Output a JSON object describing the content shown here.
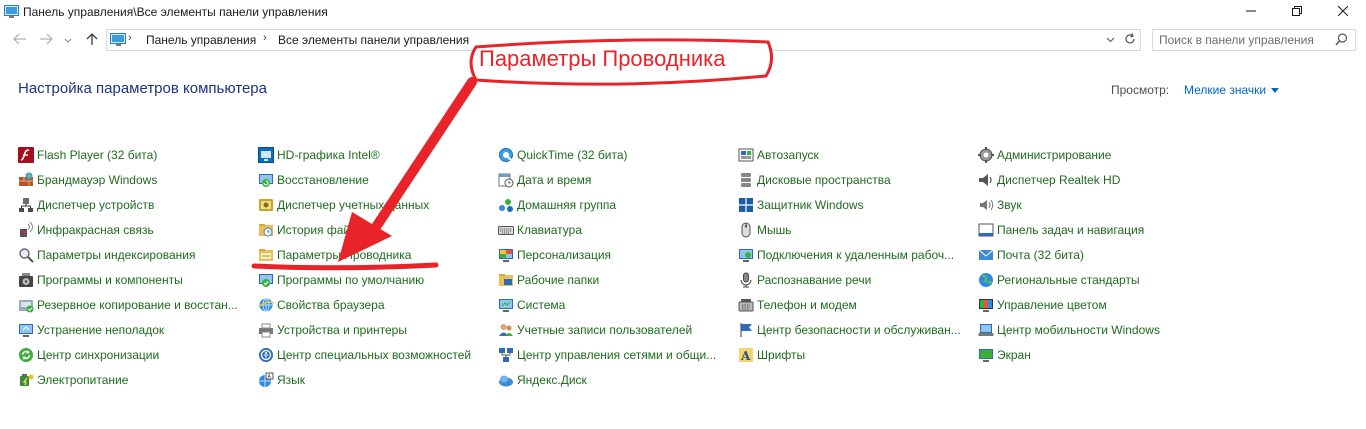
{
  "window": {
    "title": "Панель управления\\Все элементы панели управления",
    "minimize_icon": "minimize-icon",
    "maximize_icon": "maximize-icon",
    "close_icon": "close-icon"
  },
  "nav": {
    "breadcrumb": [
      "Панель управления",
      "Все элементы панели управления"
    ],
    "search_placeholder": "Поиск в панели управления"
  },
  "header": {
    "title": "Настройка параметров компьютера",
    "view_label": "Просмотр:",
    "view_value": "Мелкие значки"
  },
  "annotation": {
    "text": "Параметры Проводника",
    "color": "#e8242a"
  },
  "items": {
    "col1": [
      {
        "label": "Flash Player (32 бита)",
        "icon": "flash-icon"
      },
      {
        "label": "Брандмауэр Windows",
        "icon": "firewall-icon"
      },
      {
        "label": "Диспетчер устройств",
        "icon": "device-manager-icon"
      },
      {
        "label": "Инфракрасная связь",
        "icon": "infrared-icon"
      },
      {
        "label": "Параметры индексирования",
        "icon": "indexing-icon"
      },
      {
        "label": "Программы и компоненты",
        "icon": "programs-icon"
      },
      {
        "label": "Резервное копирование и восстан...",
        "icon": "backup-icon"
      },
      {
        "label": "Устранение неполадок",
        "icon": "troubleshoot-icon"
      },
      {
        "label": "Центр синхронизации",
        "icon": "sync-center-icon"
      },
      {
        "label": "Электропитание",
        "icon": "power-icon"
      }
    ],
    "col2": [
      {
        "label": "HD-графика Intel®",
        "icon": "intel-graphics-icon"
      },
      {
        "label": "Восстановление",
        "icon": "recovery-icon"
      },
      {
        "label": "Диспетчер учетных данных",
        "icon": "credential-manager-icon"
      },
      {
        "label": "История файлов",
        "icon": "file-history-icon"
      },
      {
        "label": "Параметры Проводника",
        "icon": "explorer-options-icon"
      },
      {
        "label": "Программы по умолчанию",
        "icon": "default-programs-icon"
      },
      {
        "label": "Свойства браузера",
        "icon": "internet-options-icon"
      },
      {
        "label": "Устройства и принтеры",
        "icon": "devices-printers-icon"
      },
      {
        "label": "Центр специальных возможностей",
        "icon": "ease-of-access-icon"
      },
      {
        "label": "Язык",
        "icon": "language-icon"
      }
    ],
    "col3": [
      {
        "label": "QuickTime (32 бита)",
        "icon": "quicktime-icon"
      },
      {
        "label": "Дата и время",
        "icon": "date-time-icon"
      },
      {
        "label": "Домашняя группа",
        "icon": "homegroup-icon"
      },
      {
        "label": "Клавиатура",
        "icon": "keyboard-icon"
      },
      {
        "label": "Персонализация",
        "icon": "personalization-icon"
      },
      {
        "label": "Рабочие папки",
        "icon": "work-folders-icon"
      },
      {
        "label": "Система",
        "icon": "system-icon"
      },
      {
        "label": "Учетные записи пользователей",
        "icon": "user-accounts-icon"
      },
      {
        "label": "Центр управления сетями и общи...",
        "icon": "network-center-icon"
      },
      {
        "label": "Яндекс.Диск",
        "icon": "yandex-disk-icon"
      }
    ],
    "col4": [
      {
        "label": "Автозапуск",
        "icon": "autoplay-icon"
      },
      {
        "label": "Дисковые пространства",
        "icon": "storage-spaces-icon"
      },
      {
        "label": "Защитник Windows",
        "icon": "defender-icon"
      },
      {
        "label": "Мышь",
        "icon": "mouse-icon"
      },
      {
        "label": "Подключения к удаленным рабоч...",
        "icon": "remote-desktop-icon"
      },
      {
        "label": "Распознавание речи",
        "icon": "speech-icon"
      },
      {
        "label": "Телефон и модем",
        "icon": "phone-modem-icon"
      },
      {
        "label": "Центр безопасности и обслуживан...",
        "icon": "security-center-icon"
      },
      {
        "label": "Шрифты",
        "icon": "fonts-icon"
      }
    ],
    "col5": [
      {
        "label": "Администрирование",
        "icon": "admin-tools-icon"
      },
      {
        "label": "Диспетчер Realtek HD",
        "icon": "realtek-icon"
      },
      {
        "label": "Звук",
        "icon": "sound-icon"
      },
      {
        "label": "Панель задач и навигация",
        "icon": "taskbar-icon"
      },
      {
        "label": "Почта (32 бита)",
        "icon": "mail-icon"
      },
      {
        "label": "Региональные стандарты",
        "icon": "region-icon"
      },
      {
        "label": "Управление цветом",
        "icon": "color-management-icon"
      },
      {
        "label": "Центр мобильности Windows",
        "icon": "mobility-center-icon"
      },
      {
        "label": "Экран",
        "icon": "display-icon"
      }
    ]
  }
}
